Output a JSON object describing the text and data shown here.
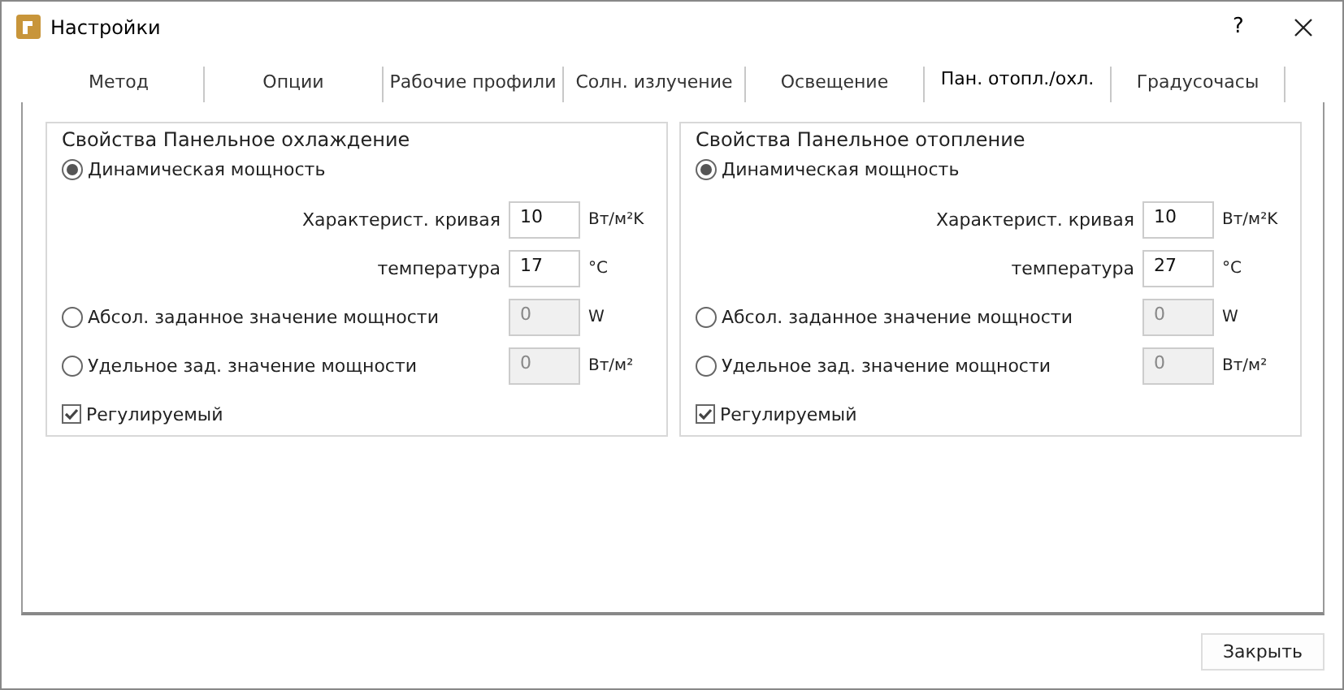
{
  "window": {
    "title": "Настройки",
    "help": "?"
  },
  "tabs": [
    {
      "label": "Метод",
      "selected": false
    },
    {
      "label": "Опции",
      "selected": false
    },
    {
      "label": "Рабочие профили",
      "selected": false
    },
    {
      "label": "Солн. излучение",
      "selected": false
    },
    {
      "label": "Освещение",
      "selected": false
    },
    {
      "label": "Пан. отопл./охл.",
      "selected": true
    },
    {
      "label": "Градусочасы",
      "selected": false
    }
  ],
  "groups": [
    {
      "title": "Свойства Панельное охлаждение",
      "options": [
        {
          "kind": "radio",
          "label": "Динамическая мощность",
          "selected": true
        },
        {
          "kind": "param",
          "label": "Характерист. кривая",
          "value": "10",
          "unit": "Вт/м²K",
          "disabled": false
        },
        {
          "kind": "param",
          "label": "температура",
          "value": "17",
          "unit": "°C",
          "disabled": false
        },
        {
          "kind": "radio-field",
          "label": "Абсол. заданное значение мощности",
          "selected": false,
          "value": "0",
          "unit": "W",
          "disabled": true
        },
        {
          "kind": "radio-field",
          "label": "Удельное зад. значение мощности",
          "selected": false,
          "value": "0",
          "unit": "Вт/м²",
          "disabled": true
        },
        {
          "kind": "checkbox",
          "label": "Регулируемый",
          "checked": true
        }
      ]
    },
    {
      "title": "Свойства Панельное отопление",
      "options": [
        {
          "kind": "radio",
          "label": "Динамическая мощность",
          "selected": true
        },
        {
          "kind": "param",
          "label": "Характерист. кривая",
          "value": "10",
          "unit": "Вт/м²K",
          "disabled": false
        },
        {
          "kind": "param",
          "label": "температура",
          "value": "27",
          "unit": "°C",
          "disabled": false
        },
        {
          "kind": "radio-field",
          "label": "Абсол. заданное значение мощности",
          "selected": false,
          "value": "0",
          "unit": "W",
          "disabled": true
        },
        {
          "kind": "radio-field",
          "label": "Удельное зад. значение мощности",
          "selected": false,
          "value": "0",
          "unit": "Вт/м²",
          "disabled": true
        },
        {
          "kind": "checkbox",
          "label": "Регулируемый",
          "checked": true
        }
      ]
    }
  ],
  "buttons": [
    "Закрыть"
  ]
}
